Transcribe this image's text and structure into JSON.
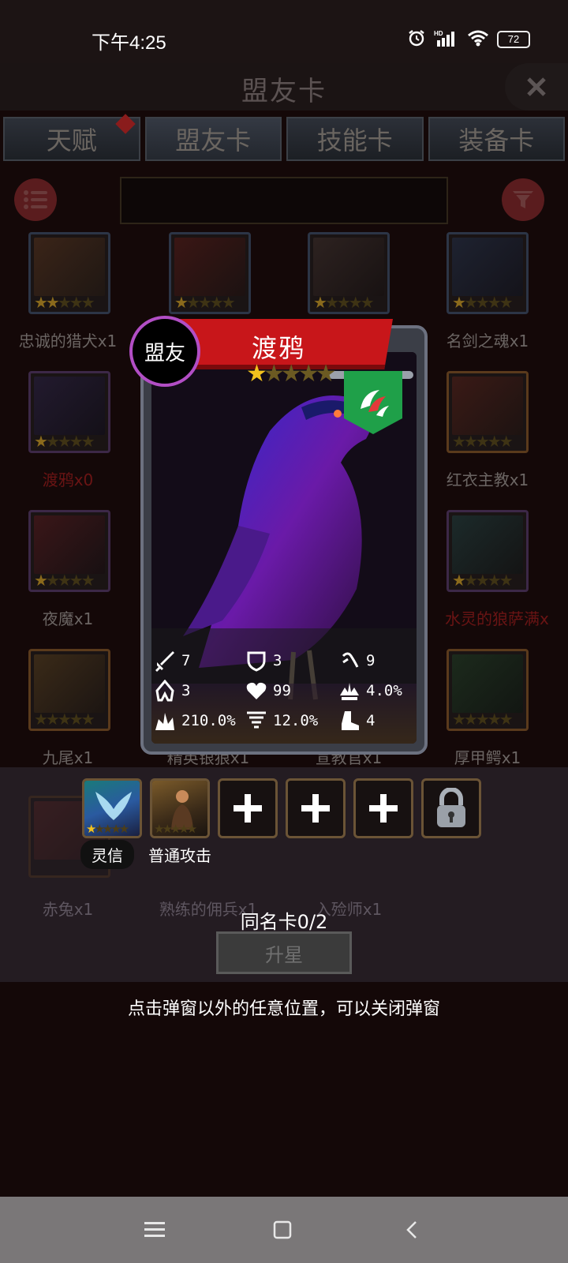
{
  "status_bar": {
    "time": "下午4:25",
    "battery": "72",
    "icons": [
      "alarm-icon",
      "hd-signal-icon",
      "wifi-icon",
      "battery-icon"
    ]
  },
  "header": {
    "title": "盟友卡",
    "close_icon": "close-icon"
  },
  "tabs": [
    {
      "label": "天赋",
      "badge": true
    },
    {
      "label": "盟友卡",
      "active": true
    },
    {
      "label": "技能卡"
    },
    {
      "label": "装备卡"
    }
  ],
  "toolbar": {
    "list_icon": "list-icon",
    "filter_icon": "filter-icon",
    "search_value": ""
  },
  "cards": [
    {
      "label": "忠诚的猎犬x1",
      "stars": 2
    },
    {
      "label": "",
      "stars": 1
    },
    {
      "label": "",
      "stars": 1
    },
    {
      "label": "名剑之魂x1",
      "stars": 1
    },
    {
      "label": "渡鸦x0",
      "stars": 1
    },
    {
      "label": "红衣主教x1",
      "stars": 0
    },
    {
      "label": "夜魔x1",
      "stars": 1
    },
    {
      "label": "水灵的狼萨满x",
      "stars": 1
    },
    {
      "label": "九尾x1",
      "stars": 0
    },
    {
      "label": "精英银狼x1",
      "stars": 0
    },
    {
      "label": "宣教官x1",
      "stars": 0
    },
    {
      "label": "厚甲鳄x1",
      "stars": 0
    },
    {
      "label": "赤兔x1",
      "stars": 0
    },
    {
      "label": "熟练的佣兵x1",
      "stars": 0
    },
    {
      "label": "入殓师x1",
      "stars": 0
    }
  ],
  "modal": {
    "badge": "盟友",
    "name": "渡鸦",
    "stars": 1,
    "max_stars": 5,
    "class_icon": "claw-icon",
    "stats": [
      {
        "icon": "sword-icon",
        "value": "7"
      },
      {
        "icon": "shield-icon",
        "value": "3"
      },
      {
        "icon": "dodge-icon",
        "value": "9"
      },
      {
        "icon": "hood-icon",
        "value": "3"
      },
      {
        "icon": "heart-icon",
        "value": "99"
      },
      {
        "icon": "crit-icon",
        "value": "4.0%"
      },
      {
        "icon": "crit-damage-icon",
        "value": "210.0%"
      },
      {
        "icon": "tornado-icon",
        "value": "12.0%"
      },
      {
        "icon": "boot-icon",
        "value": "4"
      }
    ]
  },
  "skills": [
    {
      "label": "灵信",
      "stars": 1
    },
    {
      "label": "普通攻击",
      "stars": 0
    },
    {
      "icon": "plus-icon"
    },
    {
      "icon": "plus-icon"
    },
    {
      "icon": "plus-icon"
    },
    {
      "icon": "lock-icon"
    }
  ],
  "duplicate": "同名卡0/2",
  "upgrade_label": "升星",
  "hint": "点击弹窗以外的任意位置，可以关闭弹窗",
  "nav": {
    "menu_icon": "menu-icon",
    "home_icon": "home-icon",
    "back_icon": "back-icon"
  }
}
